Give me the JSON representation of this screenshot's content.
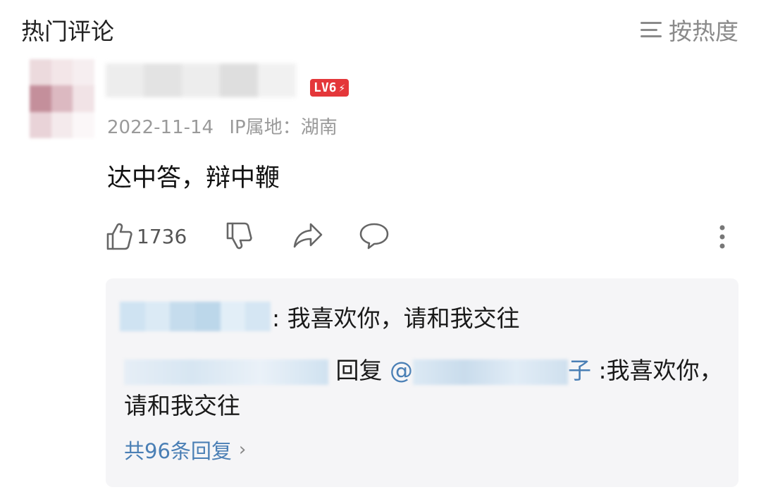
{
  "header": {
    "section_title": "热门评论",
    "sort_label": "按热度",
    "sort_icon": "menu-lines-icon"
  },
  "comment": {
    "avatar_icon": "avatar-pixelated",
    "level_badge": "LV6",
    "badge_icon": "lightning-icon",
    "date": "2022-11-14",
    "ip_location": "IP属地：湖南",
    "text": "达中答，辩中鞭",
    "like_count": "1736",
    "accent_color": "#e4373a"
  },
  "replies": {
    "first_reply_text": ": 我喜欢你，请和我交往",
    "second_reply_prefix": "回复",
    "mention_at": "@",
    "mention_tail": "子",
    "second_reply_text": ":我喜欢你，请和我交往",
    "more_replies_label": "共96条回复",
    "link_color": "#4a7fb5"
  }
}
